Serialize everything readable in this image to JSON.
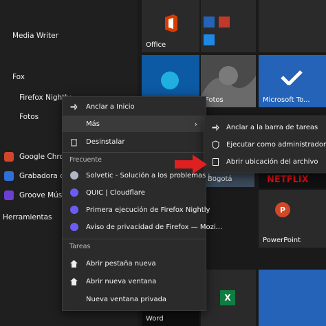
{
  "app_list": [
    {
      "label": "Media Writer",
      "icon": "media-writer-icon",
      "color": "#2d2d2d"
    },
    {
      "label": "Fox",
      "icon": "firefox-icon",
      "color": "#2d2d2d"
    },
    {
      "label": "Firefox Nightly",
      "icon": "firefox-nightly-icon",
      "color": "#2d2d2d"
    },
    {
      "label": "Fotos",
      "icon": "photos-icon",
      "color": "#2d2d2d"
    },
    {
      "label": "Google Chrome",
      "icon": "chrome-icon",
      "color": "#d1462b"
    },
    {
      "label": "Grabadora de",
      "icon": "recorder-icon",
      "color": "#2f6fd8"
    },
    {
      "label": "Groove Música",
      "icon": "groove-icon",
      "color": "#6b3fd1"
    },
    {
      "label": "Herramientas",
      "icon": "tools-icon",
      "color": "#2d2d2d"
    }
  ],
  "tiles": {
    "office": "Office",
    "fotos": "Fotos",
    "microsoft_to_do": "Microsoft To...",
    "bogota": "Bogotá",
    "netflix": "NETFLIX",
    "powerpoint": "PowerPoint",
    "word": "Word"
  },
  "context_menu": {
    "pin_to_start": "Anclar a Inicio",
    "more": "Más",
    "uninstall": "Desinstalar",
    "frequent_header": "Frecuente",
    "frequent": [
      "Solvetic - Solución a los problemas i...",
      "QUIC | Cloudflare",
      "Primera ejecución de Firefox Nightly",
      "Aviso de privacidad de Firefox — Mozi..."
    ],
    "tasks_header": "Tareas",
    "tasks": [
      "Abrir pestaña nueva",
      "Abrir nueva ventana",
      "Nueva ventana privada"
    ]
  },
  "submenu": {
    "pin_taskbar": "Anclar a la barra de tareas",
    "run_admin": "Ejecutar como administrador",
    "open_location": "Abrir ubicación del archivo"
  },
  "colors": {
    "accent_red": "#e02020",
    "office_red": "#d83b01",
    "edge_blue": "#0c59a4",
    "todo_blue": "#2563b8",
    "excel_green": "#107c41"
  }
}
